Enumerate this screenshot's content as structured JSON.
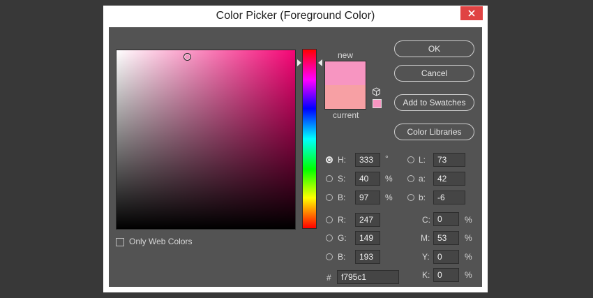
{
  "window": {
    "title": "Color Picker (Foreground Color)"
  },
  "preview": {
    "new_label": "new",
    "current_label": "current",
    "new_color": "#f795c1",
    "current_color": "#f7a0a4"
  },
  "buttons": {
    "ok": "OK",
    "cancel": "Cancel",
    "add_to_swatches": "Add to Swatches",
    "color_libraries": "Color Libraries"
  },
  "hsb": {
    "h": {
      "label": "H:",
      "value": "333",
      "unit": "°"
    },
    "s": {
      "label": "S:",
      "value": "40",
      "unit": "%"
    },
    "b": {
      "label": "B:",
      "value": "97",
      "unit": "%"
    }
  },
  "rgb": {
    "r": {
      "label": "R:",
      "value": "247"
    },
    "g": {
      "label": "G:",
      "value": "149"
    },
    "b": {
      "label": "B:",
      "value": "193"
    }
  },
  "lab": {
    "l": {
      "label": "L:",
      "value": "73"
    },
    "a": {
      "label": "a:",
      "value": "42"
    },
    "b": {
      "label": "b:",
      "value": "-6"
    }
  },
  "cmyk": {
    "c": {
      "label": "C:",
      "value": "0",
      "unit": "%"
    },
    "m": {
      "label": "M:",
      "value": "53",
      "unit": "%"
    },
    "y": {
      "label": "Y:",
      "value": "0",
      "unit": "%"
    },
    "k": {
      "label": "K:",
      "value": "0",
      "unit": "%"
    }
  },
  "hex": {
    "label": "#",
    "value": "f795c1"
  },
  "web_colors": {
    "label": "Only Web Colors"
  },
  "colors": {
    "accent": "#f50575",
    "client_bg": "#535353",
    "close": "#e04343"
  }
}
